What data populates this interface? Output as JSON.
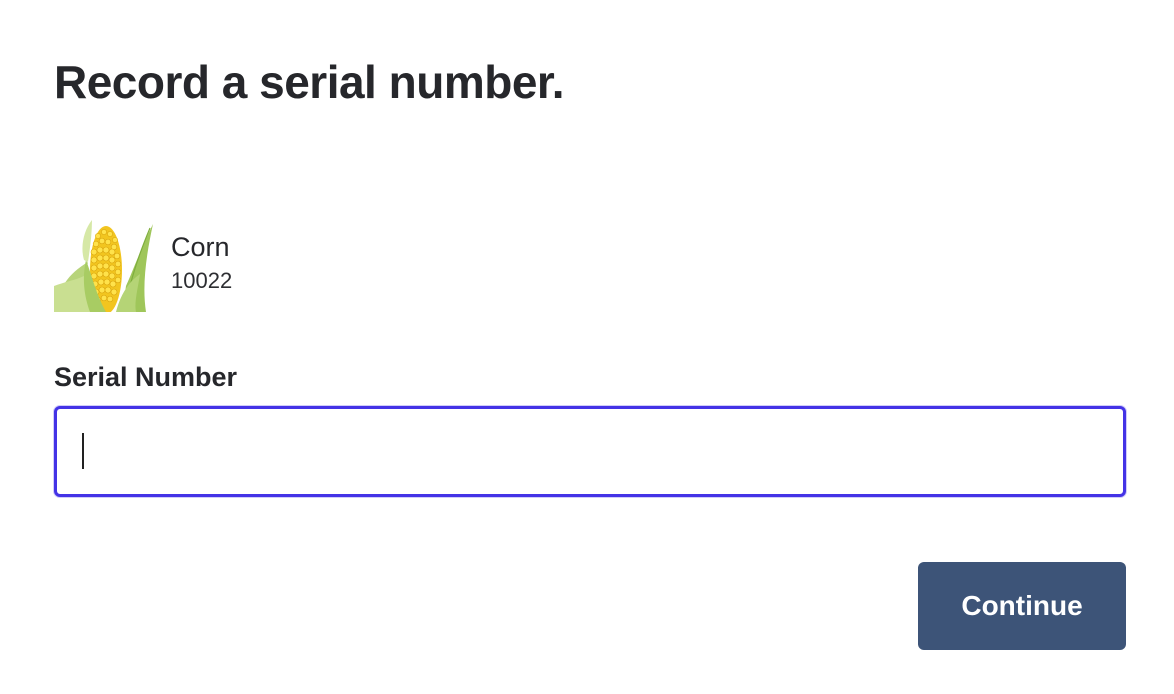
{
  "page": {
    "title": "Record a serial number."
  },
  "product": {
    "name": "Corn",
    "sku": "10022",
    "image_icon": "corn-cob-icon"
  },
  "serial_field": {
    "label": "Serial Number",
    "value": "",
    "placeholder": "",
    "focused": true,
    "focus_color": "#4433e6"
  },
  "actions": {
    "continue_label": "Continue",
    "continue_color": "#3d5478"
  }
}
